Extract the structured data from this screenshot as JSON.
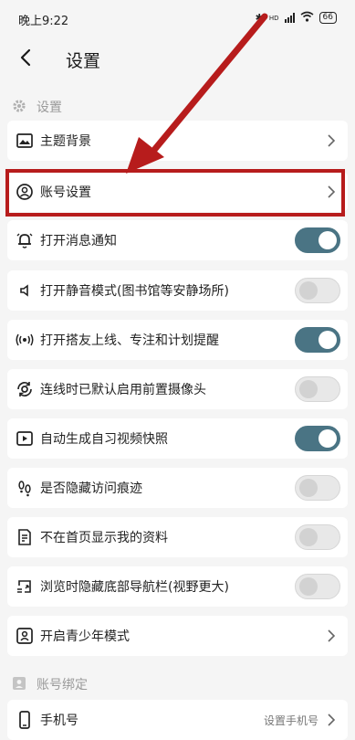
{
  "status_bar": {
    "time": "晚上9:22",
    "net_label": "HD",
    "battery": "66"
  },
  "header": {
    "title": "设置"
  },
  "sections": {
    "settings": {
      "label": "设置"
    },
    "account_binding": {
      "label": "账号绑定"
    }
  },
  "rows": [
    {
      "label": "主题背景",
      "icon": "image-icon",
      "control": "chevron"
    },
    {
      "label": "账号设置",
      "icon": "account-icon",
      "control": "chevron"
    },
    {
      "label": "打开消息通知",
      "icon": "bell-icon",
      "control": "toggle",
      "on": true
    },
    {
      "label": "打开静音模式(图书馆等安静场所)",
      "icon": "speaker-icon",
      "control": "toggle",
      "on": false
    },
    {
      "label": "打开搭友上线、专注和计划提醒",
      "icon": "broadcast-icon",
      "control": "toggle",
      "on": true
    },
    {
      "label": "连线时已默认启用前置摄像头",
      "icon": "camera-switch-icon",
      "control": "toggle",
      "on": false
    },
    {
      "label": "自动生成自习视频快照",
      "icon": "video-icon",
      "control": "toggle",
      "on": true
    },
    {
      "label": "是否隐藏访问痕迹",
      "icon": "footprints-icon",
      "control": "toggle",
      "on": false
    },
    {
      "label": "不在首页显示我的资料",
      "icon": "document-icon",
      "control": "toggle",
      "on": false
    },
    {
      "label": "浏览时隐藏底部导航栏(视野更大)",
      "icon": "navbar-icon",
      "control": "toggle",
      "on": false
    },
    {
      "label": "开启青少年模式",
      "icon": "teen-icon",
      "control": "chevron"
    }
  ],
  "phone_row": {
    "label": "手机号",
    "value": "设置手机号",
    "icon": "phone-icon"
  },
  "colors": {
    "toggle_on": "#4a7484",
    "annotation": "#b71c1c"
  }
}
